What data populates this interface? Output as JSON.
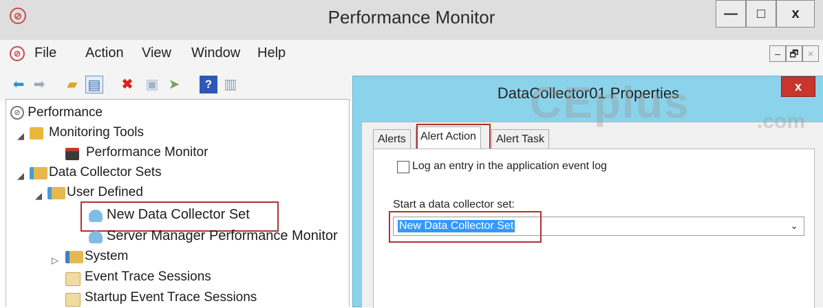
{
  "window": {
    "title": "Performance Monitor",
    "app_icon": "performance-monitor-icon",
    "minimize": "—",
    "maximize": "□",
    "close": "x"
  },
  "menu": {
    "items": [
      "File",
      "Action",
      "View",
      "Window",
      "Help"
    ],
    "mdi_minimize": "–",
    "mdi_restore": "🗗",
    "mdi_close": "×"
  },
  "toolbar": {
    "icons": [
      "back-arrow-icon",
      "forward-arrow-icon",
      "up-folder-icon",
      "show-hide-tree-icon",
      "delete-icon",
      "properties-icon",
      "export-list-icon",
      "help-icon",
      "show-hide-action-pane-icon"
    ]
  },
  "tree": {
    "nodes": [
      {
        "label": "Performance",
        "icon": "performance-icon"
      },
      {
        "label": "Monitoring Tools",
        "icon": "monitoring-tools-icon",
        "expander": "◢"
      },
      {
        "label": "Performance Monitor",
        "icon": "performance-monitor-chart-icon"
      },
      {
        "label": "Data Collector Sets",
        "icon": "data-collector-sets-icon",
        "expander": "◢"
      },
      {
        "label": "User Defined",
        "icon": "user-defined-icon",
        "expander": "◢"
      },
      {
        "label": "New Data Collector Set",
        "icon": "data-collector-set-icon",
        "selected": true
      },
      {
        "label": "Server Manager Performance Monitor",
        "icon": "data-collector-set-icon"
      },
      {
        "label": "System",
        "icon": "system-icon",
        "expander": "▷"
      },
      {
        "label": "Event Trace Sessions",
        "icon": "event-trace-icon"
      },
      {
        "label": "Startup Event Trace Sessions",
        "icon": "event-trace-icon"
      }
    ]
  },
  "dialog": {
    "title": "DataCollector01 Properties",
    "close": "x",
    "tabs": [
      "Alerts",
      "Alert Action",
      "Alert Task"
    ],
    "active_tab": "Alert Action",
    "checkbox_label": "Log an entry in the application event log",
    "checkbox_checked": false,
    "select_label": "Start a data collector set:",
    "select_value": "New Data Collector Set",
    "select_arrow": "⌄"
  },
  "watermark": {
    "text": "CEplus",
    "suffix": ".com"
  },
  "colors": {
    "dialog_frame": "#8ad3ea",
    "highlight_box": "#b03030",
    "selection": "#3399ff"
  }
}
